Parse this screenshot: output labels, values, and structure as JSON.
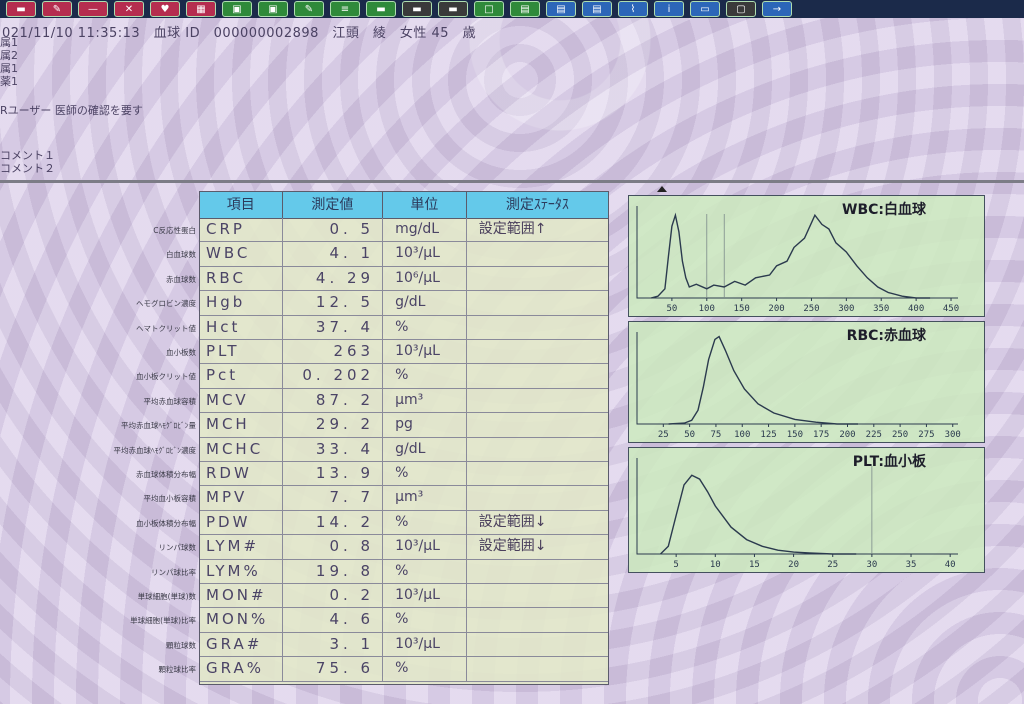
{
  "toolbar": {
    "buttons": [
      {
        "icon": "red-toolbar-icon",
        "color": "red"
      },
      {
        "icon": "pen-icon",
        "color": "red"
      },
      {
        "icon": "minus-icon",
        "color": "red"
      },
      {
        "icon": "x-icon",
        "color": "red"
      },
      {
        "icon": "heart-icon",
        "color": "red"
      },
      {
        "icon": "grid-icon",
        "color": "red"
      },
      {
        "icon": "photo-icon",
        "color": "green"
      },
      {
        "icon": "photo-icon",
        "color": "green"
      },
      {
        "icon": "edit-icon",
        "color": "green"
      },
      {
        "icon": "list-icon",
        "color": "green"
      },
      {
        "icon": "bar-icon",
        "color": "green"
      },
      {
        "icon": "bar-icon",
        "color": "dark"
      },
      {
        "icon": "bar-icon",
        "color": "dark"
      },
      {
        "icon": "square-icon",
        "color": "green"
      },
      {
        "icon": "chart-icon",
        "color": "green"
      },
      {
        "icon": "document-icon",
        "color": "blue"
      },
      {
        "icon": "document-icon",
        "color": "blue"
      },
      {
        "icon": "paperclip-icon",
        "color": "blue"
      },
      {
        "icon": "info-icon",
        "color": "blue"
      },
      {
        "icon": "monitor-icon",
        "color": "blue"
      },
      {
        "icon": "window-icon",
        "color": "dark"
      },
      {
        "icon": "arrow-right-icon",
        "color": "blue"
      }
    ]
  },
  "header": {
    "patient_line": "021/11/10 11:35:13　血球 ID　000000002898　江頭　綾　女性 45　歳",
    "lines": [
      "属1",
      "属2",
      "属1",
      "薬1"
    ],
    "user_note": "Rユーザー 医師の確認を要す",
    "comments": [
      "コメント１",
      "コメント２"
    ]
  },
  "table": {
    "headers": [
      "項目",
      "測定値",
      "単位",
      "測定ｽﾃｰﾀｽ"
    ],
    "rows": [
      {
        "label": "C反応性蛋白",
        "item": "CRP",
        "value": "0. 5",
        "unit": "mg/dL",
        "status": "設定範囲↑"
      },
      {
        "label": "白血球数",
        "item": "WBC",
        "value": "4. 1",
        "unit": "10³/μL",
        "status": ""
      },
      {
        "label": "赤血球数",
        "item": "RBC",
        "value": "4. 29",
        "unit": "10⁶/μL",
        "status": ""
      },
      {
        "label": "ヘモグロビン濃度",
        "item": "Hgb",
        "value": "12. 5",
        "unit": "g/dL",
        "status": ""
      },
      {
        "label": "ヘマトクリット値",
        "item": "Hct",
        "value": "37. 4",
        "unit": "%",
        "status": ""
      },
      {
        "label": "血小板数",
        "item": "PLT",
        "value": "263",
        "unit": "10³/μL",
        "status": ""
      },
      {
        "label": "血小板クリット値",
        "item": "Pct",
        "value": "0. 202",
        "unit": "%",
        "status": ""
      },
      {
        "label": "平均赤血球容積",
        "item": "MCV",
        "value": "87. 2",
        "unit": "μm³",
        "status": ""
      },
      {
        "label": "平均赤血球ﾍﾓｸﾞﾛﾋﾞﾝ量",
        "item": "MCH",
        "value": "29. 2",
        "unit": "pg",
        "status": ""
      },
      {
        "label": "平均赤血球ﾍﾓｸﾞﾛﾋﾞﾝ濃度",
        "item": "MCHC",
        "value": "33. 4",
        "unit": "g/dL",
        "status": ""
      },
      {
        "label": "赤血球体積分布幅",
        "item": "RDW",
        "value": "13. 9",
        "unit": "%",
        "status": ""
      },
      {
        "label": "平均血小板容積",
        "item": "MPV",
        "value": "7. 7",
        "unit": "μm³",
        "status": ""
      },
      {
        "label": "血小板体積分布幅",
        "item": "PDW",
        "value": "14. 2",
        "unit": "%",
        "status": "設定範囲↓"
      },
      {
        "label": "リンパ球数",
        "item": "LYM#",
        "value": "0. 8",
        "unit": "10³/μL",
        "status": "設定範囲↓"
      },
      {
        "label": "リンパ球比率",
        "item": "LYM%",
        "value": "19. 8",
        "unit": "%",
        "status": ""
      },
      {
        "label": "単球細胞(単球)数",
        "item": "MON#",
        "value": "0. 2",
        "unit": "10³/μL",
        "status": ""
      },
      {
        "label": "単球細胞(単球)比率",
        "item": "MON%",
        "value": "4. 6",
        "unit": "%",
        "status": ""
      },
      {
        "label": "顆粒球数",
        "item": "GRA#",
        "value": "3. 1",
        "unit": "10³/μL",
        "status": ""
      },
      {
        "label": "顆粒球比率",
        "item": "GRA%",
        "value": "75. 6",
        "unit": "%",
        "status": ""
      }
    ]
  },
  "charts": [
    {
      "title": "WBC:白血球",
      "ticks": [
        "50",
        "100",
        "150",
        "200",
        "250",
        "300",
        "350",
        "400",
        "450"
      ],
      "xlim": [
        0,
        460
      ],
      "curve": [
        [
          20,
          0
        ],
        [
          30,
          2
        ],
        [
          40,
          10
        ],
        [
          45,
          45
        ],
        [
          50,
          78
        ],
        [
          55,
          90
        ],
        [
          60,
          72
        ],
        [
          65,
          40
        ],
        [
          70,
          22
        ],
        [
          75,
          12
        ],
        [
          85,
          15
        ],
        [
          100,
          10
        ],
        [
          110,
          14
        ],
        [
          125,
          12
        ],
        [
          140,
          18
        ],
        [
          155,
          14
        ],
        [
          170,
          22
        ],
        [
          190,
          25
        ],
        [
          200,
          35
        ],
        [
          215,
          40
        ],
        [
          225,
          55
        ],
        [
          240,
          65
        ],
        [
          255,
          90
        ],
        [
          265,
          80
        ],
        [
          275,
          75
        ],
        [
          285,
          60
        ],
        [
          300,
          50
        ],
        [
          315,
          35
        ],
        [
          330,
          22
        ],
        [
          345,
          12
        ],
        [
          360,
          6
        ],
        [
          380,
          2
        ],
        [
          400,
          0
        ],
        [
          420,
          0
        ]
      ],
      "markers": [
        100,
        125
      ]
    },
    {
      "title": "RBC:赤血球",
      "ticks": [
        "25",
        "50",
        "75",
        "100",
        "125",
        "150",
        "175",
        "200",
        "225",
        "250",
        "275",
        "300"
      ],
      "xlim": [
        0,
        305
      ],
      "curve": [
        [
          30,
          0
        ],
        [
          45,
          1
        ],
        [
          52,
          4
        ],
        [
          58,
          15
        ],
        [
          63,
          40
        ],
        [
          68,
          70
        ],
        [
          74,
          92
        ],
        [
          78,
          95
        ],
        [
          84,
          80
        ],
        [
          92,
          58
        ],
        [
          102,
          38
        ],
        [
          115,
          22
        ],
        [
          130,
          12
        ],
        [
          150,
          5
        ],
        [
          170,
          2
        ],
        [
          190,
          0
        ],
        [
          210,
          0
        ]
      ],
      "markers": []
    },
    {
      "title": "PLT:血小板",
      "ticks": [
        "5",
        "10",
        "15",
        "20",
        "25",
        "30",
        "35",
        "40"
      ],
      "xlim": [
        0,
        41
      ],
      "curve": [
        [
          3,
          0
        ],
        [
          4,
          8
        ],
        [
          5,
          40
        ],
        [
          6,
          72
        ],
        [
          7,
          82
        ],
        [
          8,
          78
        ],
        [
          9,
          65
        ],
        [
          10,
          50
        ],
        [
          12,
          28
        ],
        [
          14,
          15
        ],
        [
          16,
          8
        ],
        [
          18,
          4
        ],
        [
          20,
          2
        ],
        [
          22,
          1
        ],
        [
          25,
          0
        ],
        [
          28,
          0
        ]
      ],
      "markers": [
        30
      ]
    }
  ],
  "colors": {
    "header_bg": "#64c9ea",
    "table_bg": "#e2e8c8",
    "chart_bg": "#cdeabe",
    "text": "#4b4466",
    "curve": "#2b3a4e"
  }
}
